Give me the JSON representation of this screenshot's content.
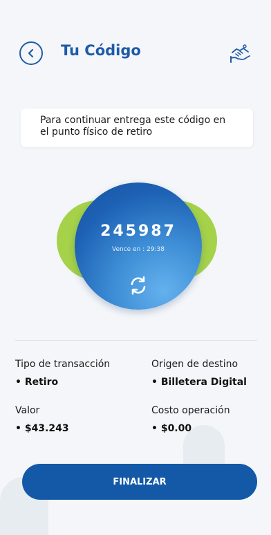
{
  "header": {
    "title": "Tu Código",
    "back_icon": "chevron-left-icon",
    "help_icon": "handshake-icon"
  },
  "notice": {
    "text": "Para continuar entrega este código en el punto físico de retiro"
  },
  "code": {
    "value": "245987",
    "expiry": "Vence en : 29:38",
    "refresh_icon": "refresh-icon"
  },
  "details": {
    "transaction_type_label": "Tipo de transacción",
    "transaction_type_value": "• Retiro",
    "destination_label": "Origen de destino",
    "destination_value": "• Billetera Digital",
    "amount_label": "Valor",
    "amount_value": "• $43.243",
    "fee_label": "Costo operación",
    "fee_value": "• $0.00"
  },
  "footer": {
    "finish_label": "FINALIZAR"
  },
  "colors": {
    "primary": "#1e5aa8",
    "button": "#1359a8",
    "accent_green": "#a6d24a",
    "background": "#f4f6f9"
  }
}
